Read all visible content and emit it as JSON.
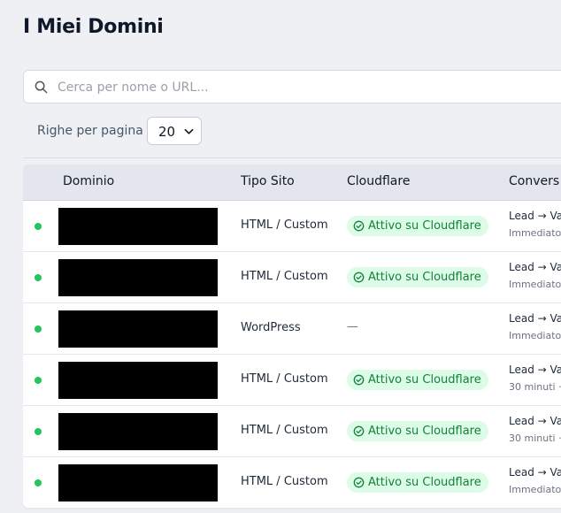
{
  "page": {
    "title": "I Miei Domini"
  },
  "search": {
    "placeholder": "Cerca per nome o URL..."
  },
  "pagination": {
    "label": "Righe per pagina",
    "value": "20"
  },
  "table": {
    "headers": [
      "Dominio",
      "Tipo Sito",
      "Cloudflare",
      "Convers"
    ],
    "rows": [
      {
        "status": "active",
        "type": "HTML / Custom",
        "cloudflare": "Attivo su Cloudflare",
        "conv_line1": "Lead → Va",
        "conv_line2": "Immediato"
      },
      {
        "status": "active",
        "type": "HTML / Custom",
        "cloudflare": "Attivo su Cloudflare",
        "conv_line1": "Lead → Va",
        "conv_line2": "Immediato"
      },
      {
        "status": "active",
        "type": "WordPress",
        "cloudflare": "—",
        "conv_line1": "Lead → Va",
        "conv_line2": "Immediato"
      },
      {
        "status": "active",
        "type": "HTML / Custom",
        "cloudflare": "Attivo su Cloudflare",
        "conv_line1": "Lead → Va",
        "conv_line2": "30 minuti ·"
      },
      {
        "status": "active",
        "type": "HTML / Custom",
        "cloudflare": "Attivo su Cloudflare",
        "conv_line1": "Lead → Va",
        "conv_line2": "30 minuti ·"
      },
      {
        "status": "active",
        "type": "HTML / Custom",
        "cloudflare": "Attivo su Cloudflare",
        "conv_line1": "Lead → Va",
        "conv_line2": "Immediato"
      }
    ]
  },
  "colors": {
    "status_active": "#22c55e",
    "badge_bg": "#dcfce7",
    "badge_text": "#15803d"
  },
  "icons": {
    "search": "search-icon",
    "badge": "check-circle-icon",
    "select": "chevron-down-icon"
  }
}
